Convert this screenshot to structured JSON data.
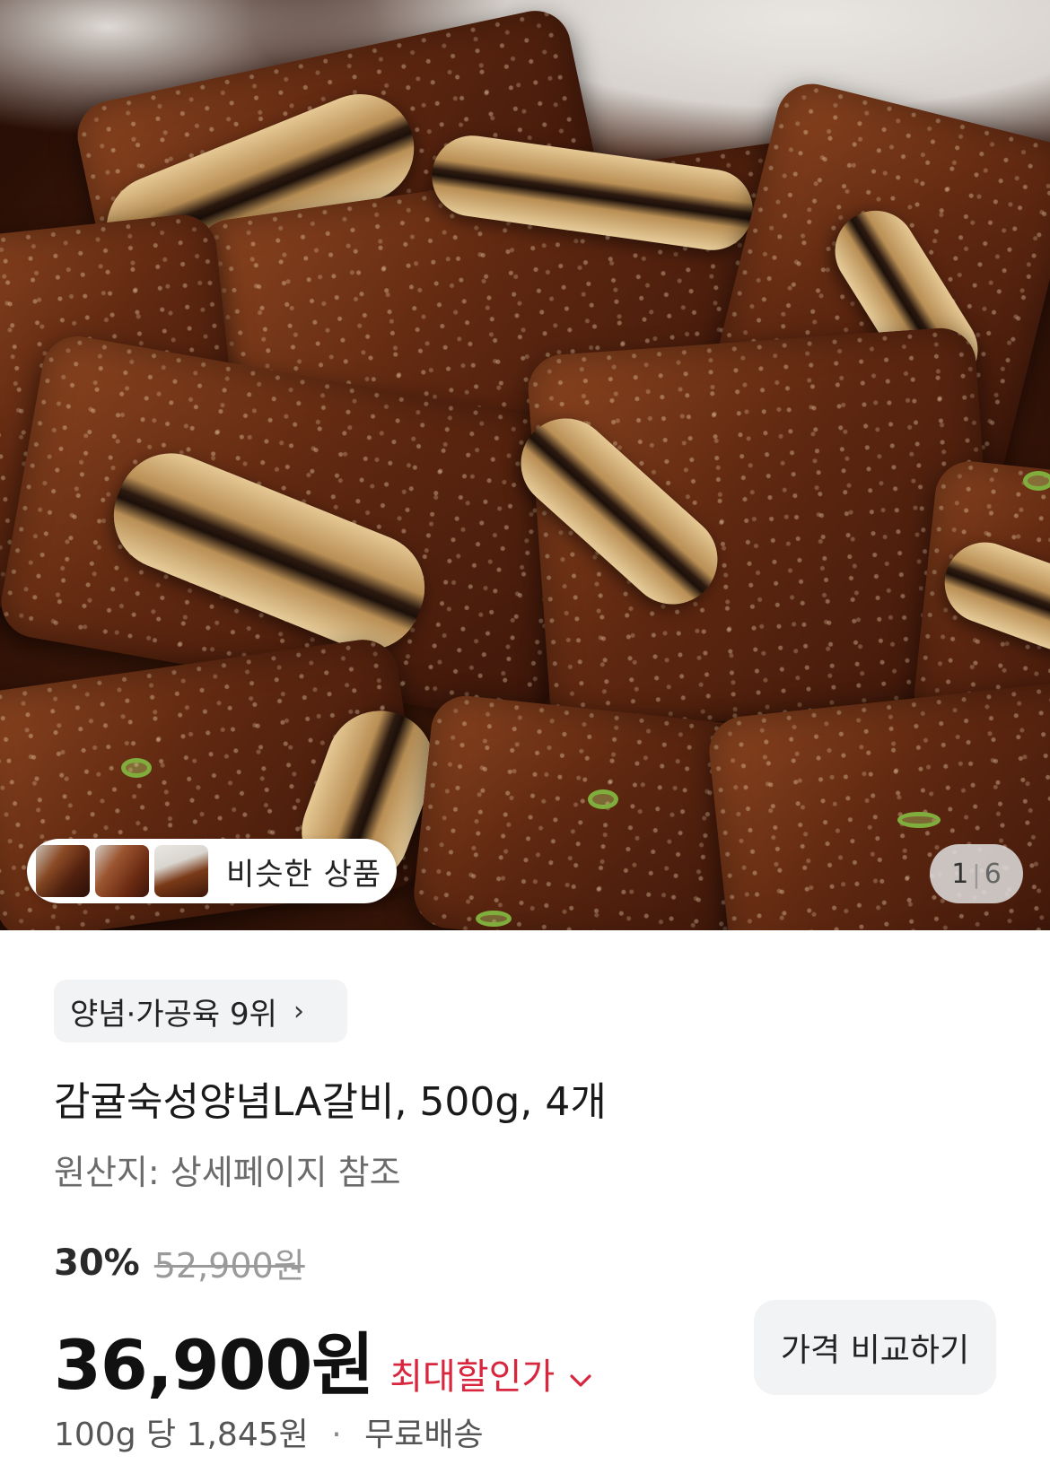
{
  "gallery": {
    "similar_label": "비슷한 상품",
    "counter_current": "1",
    "counter_total": "6"
  },
  "rank_badge": {
    "label": "양념·가공육 9위",
    "chevron": "›"
  },
  "product": {
    "title": "감귤숙성양념LA갈비, 500g, 4개",
    "origin": "원산지: 상세페이지 참조"
  },
  "pricing": {
    "discount_rate": "30%",
    "original_price": "52,900원",
    "sale_price": "36,900원",
    "max_discount_label": "최대할인가",
    "compare_button": "가격 비교하기",
    "unit_price": "100g 당 1,845원",
    "separator": "·",
    "shipping": "무료배송"
  },
  "colors": {
    "accent_red": "#d7263d",
    "chip_bg": "#f1f3f5"
  }
}
